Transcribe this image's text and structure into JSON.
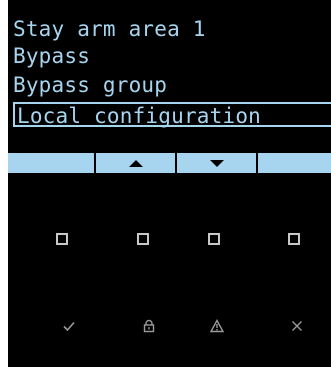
{
  "menu": {
    "items": [
      {
        "label": "Stay arm area 1"
      },
      {
        "label": "Bypass"
      },
      {
        "label": "Bypass group"
      },
      {
        "label": "Local configuration"
      }
    ],
    "selected_index": 3
  },
  "softkeys": [
    {
      "icon": "blank"
    },
    {
      "icon": "up-arrow-icon"
    },
    {
      "icon": "down-arrow-icon"
    },
    {
      "icon": "blank"
    }
  ],
  "action_keys": [
    {
      "icon": "check-icon"
    },
    {
      "icon": "lock-icon"
    },
    {
      "icon": "warning-icon"
    },
    {
      "icon": "close-icon"
    }
  ],
  "colors": {
    "lcd_text": "#a7d4ee",
    "background": "#000000",
    "key_outline": "#c8c8c8",
    "action_icon": "#9a9a9a"
  }
}
